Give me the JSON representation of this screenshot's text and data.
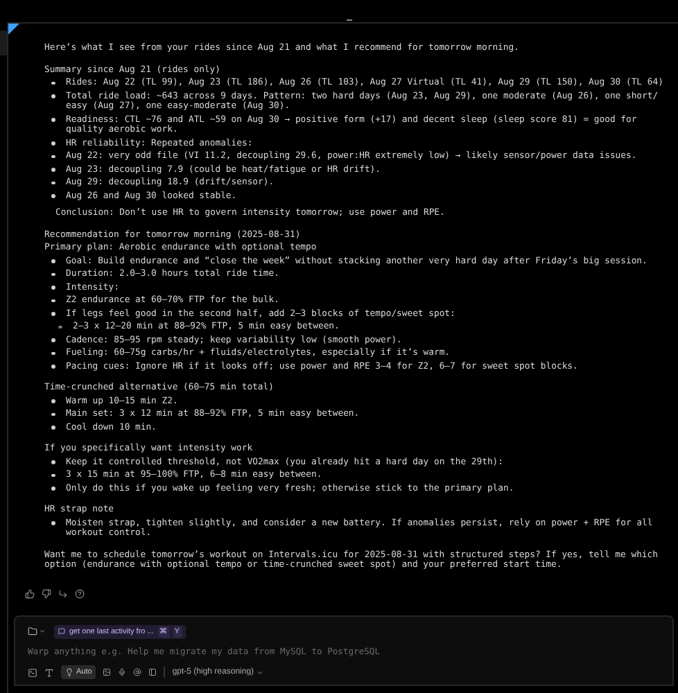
{
  "message": {
    "sections": [
      {
        "blocks": [
          {
            "kind": "paragraph",
            "text": "Here’s what I see from your rides since Aug 21 and what I recommend for tomorrow morning."
          }
        ]
      },
      {
        "blocks": [
          {
            "kind": "heading",
            "text": "Summary since Aug 21 (rides only)"
          },
          {
            "kind": "bullet",
            "text": "Rides: Aug 22 (TL 99), Aug 23 (TL 186), Aug 26 (TL 103), Aug 27 Virtual (TL 41), Aug 29 (TL 150), Aug 30 (TL 64)"
          },
          {
            "kind": "bullet",
            "text": "Total ride load: ~643 across 9 days. Pattern: two hard days (Aug 23, Aug 29), one moderate (Aug 26), one short/ easy (Aug 27), one easy-moderate (Aug 30)."
          },
          {
            "kind": "bullet",
            "text": "Readiness: CTL ~76 and ATL ~59 on Aug 30 → positive form (+17) and decent sleep (sleep score 81) = good for quality aerobic work."
          },
          {
            "kind": "bullet",
            "text": "HR reliability: Repeated anomalies:"
          },
          {
            "kind": "bullet",
            "text": "Aug 22: very odd file (VI 11.2, decoupling 29.6, power:HR extremely low) → likely sensor/power data issues."
          },
          {
            "kind": "bullet",
            "text": "Aug 23: decoupling 7.9 (could be heat/fatigue or HR drift)."
          },
          {
            "kind": "bullet",
            "text": "Aug 29: decoupling 18.9 (drift/sensor)."
          },
          {
            "kind": "bullet",
            "text": "Aug 26 and Aug 30 looked stable."
          },
          {
            "kind": "note",
            "text": "Conclusion: Don’t use HR to govern intensity tomorrow; use power and RPE."
          }
        ]
      },
      {
        "blocks": [
          {
            "kind": "heading",
            "text": "Recommendation for tomorrow morning (2025-08-31)"
          },
          {
            "kind": "heading",
            "text": "Primary plan: Aerobic endurance with optional tempo"
          },
          {
            "kind": "bullet",
            "text": "Goal: Build endurance and “close the week” without stacking another very hard day after Friday’s big session."
          },
          {
            "kind": "bullet",
            "text": "Duration: 2.0–3.0 hours total ride time."
          },
          {
            "kind": "bullet",
            "text": "Intensity:"
          },
          {
            "kind": "bullet",
            "text": "Z2 endurance at 60–70% FTP for the bulk."
          },
          {
            "kind": "bullet",
            "text": "If legs feel good in the second half, add 2–3 blocks of tempo/sweet spot:",
            "children": [
              {
                "kind": "bullet",
                "text": "2–3 x 12–20 min at 88–92% FTP, 5 min easy between."
              }
            ]
          },
          {
            "kind": "bullet",
            "text": "Cadence: 85–95 rpm steady; keep variability low (smooth power)."
          },
          {
            "kind": "bullet",
            "text": "Fueling: 60–75g carbs/hr + fluids/electrolytes, especially if it’s warm."
          },
          {
            "kind": "bullet",
            "text": "Pacing cues: Ignore HR if it looks off; use power and RPE 3–4 for Z2, 6–7 for sweet spot blocks."
          }
        ]
      },
      {
        "blocks": [
          {
            "kind": "heading",
            "text": "Time-crunched alternative (60–75 min total)"
          },
          {
            "kind": "bullet",
            "text": "Warm up 10–15 min Z2."
          },
          {
            "kind": "bullet",
            "text": "Main set: 3 x 12 min at 88–92% FTP, 5 min easy between."
          },
          {
            "kind": "bullet",
            "text": "Cool down 10 min."
          }
        ]
      },
      {
        "blocks": [
          {
            "kind": "heading",
            "text": "If you specifically want intensity work"
          },
          {
            "kind": "bullet",
            "text": "Keep it controlled threshold, not VO2max (you already hit a hard day on the 29th):"
          },
          {
            "kind": "bullet",
            "text": "3 x 15 min at 95–100% FTP, 6–8 min easy between."
          },
          {
            "kind": "bullet",
            "text": "Only do this if you wake up feeling very fresh; otherwise stick to the primary plan."
          }
        ]
      },
      {
        "blocks": [
          {
            "kind": "heading",
            "text": "HR strap note"
          },
          {
            "kind": "bullet",
            "text": "Moisten strap, tighten slightly, and consider a new battery. If anomalies persist, rely on power + RPE for all workout control."
          }
        ]
      },
      {
        "blocks": [
          {
            "kind": "paragraph",
            "text": "Want me to schedule tomorrow’s workout on Intervals.icu for 2025-08-31 with structured steps? If yes, tell me which option (endurance with optional tempo or time-crunched sweet spot) and your preferred start time."
          }
        ]
      }
    ]
  },
  "composer": {
    "context_chip": {
      "label": "get one last activity fro ...",
      "keys": [
        "⌘",
        "Y"
      ]
    },
    "placeholder": "Warp anything e.g. Help me migrate my data from MySQL to PostgreSQL",
    "mode": {
      "label": "Auto",
      "selected": true
    },
    "model": "gpt-5 (high reasoning)"
  }
}
